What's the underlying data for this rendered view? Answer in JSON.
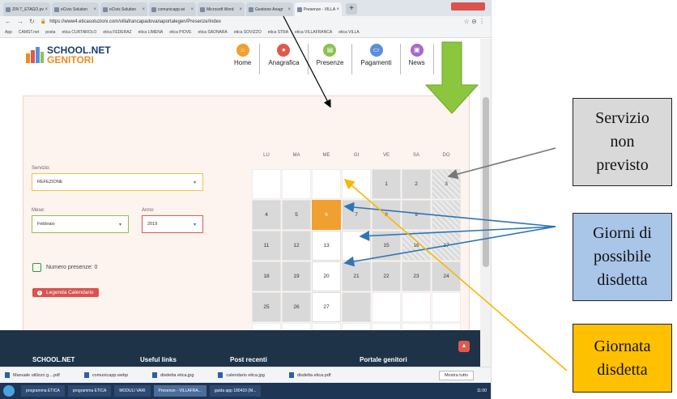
{
  "browser": {
    "tabs": [
      {
        "label": "ZIN T_ETAGO.pv"
      },
      {
        "label": "eCivis Solution"
      },
      {
        "label": "eCivis Solution"
      },
      {
        "label": "comunicapp.wi"
      },
      {
        "label": "Microsoft Word"
      },
      {
        "label": "Gestione Anagr"
      },
      {
        "label": "Presenze - VILLA"
      }
    ],
    "url": "https://www4.eticasoluzioni.com/villafrancapadovanaportalegen/Presenze/Index",
    "bookmarks": [
      "App",
      "CAMST.net",
      "posta",
      "etica CURTAROLO",
      "etica FEDERAZ",
      "etica LIMENA",
      "etica PIOVE",
      "etica SAONARA",
      "etica SOVIZZO",
      "etica STRA",
      "etica VILLAFRANCA",
      "etica VILLA"
    ]
  },
  "header": {
    "logo_line1": "SCHOOL.NET",
    "logo_line2": "GENITORI",
    "menu": [
      {
        "label": "Home",
        "color": "#f0a030"
      },
      {
        "label": "Anagrafica",
        "color": "#e0594c"
      },
      {
        "label": "Presenze",
        "color": "#8cc152"
      },
      {
        "label": "Pagamenti",
        "color": "#5b8fd9"
      },
      {
        "label": "News",
        "color": "#a56bc7"
      },
      {
        "label": "U",
        "color": "#e8a5b8"
      }
    ]
  },
  "form": {
    "servizio_label": "Servizio:",
    "servizio_value": "REFEZIONE",
    "mese_label": "Mese:",
    "mese_value": "Febbraio",
    "anno_label": "Anno:",
    "anno_value": "2019",
    "presenze_text": "Numero presenze: 0",
    "legend_button": "Legenda Calendario"
  },
  "calendar": {
    "weekdays": [
      "LU",
      "MA",
      "ME",
      "GI",
      "VE",
      "SA",
      "DO"
    ],
    "rows": [
      [
        "",
        "",
        "",
        "",
        "1",
        "2",
        "3"
      ],
      [
        "4",
        "5",
        "6",
        "7",
        "8",
        "9",
        ""
      ],
      [
        "11",
        "12",
        "13",
        "",
        "15",
        "16",
        "17"
      ],
      [
        "18",
        "19",
        "20",
        "21",
        "22",
        "23",
        "24"
      ],
      [
        "25",
        "26",
        "27",
        "",
        "",
        "",
        ""
      ],
      [
        "",
        "",
        "",
        "",
        "",
        "",
        ""
      ]
    ],
    "states": [
      [
        "empty",
        "empty",
        "empty",
        "empty",
        "grey",
        "grey",
        "hatch"
      ],
      [
        "grey",
        "grey",
        "orange",
        "grey",
        "grey",
        "grey",
        "hatch"
      ],
      [
        "grey",
        "grey",
        "white",
        "white",
        "grey",
        "hatch",
        "hatch"
      ],
      [
        "grey",
        "grey",
        "white",
        "grey",
        "grey",
        "grey",
        "grey"
      ],
      [
        "grey",
        "grey",
        "white",
        "grey",
        "empty",
        "empty",
        "empty"
      ],
      [
        "empty",
        "empty",
        "empty",
        "empty",
        "empty",
        "empty",
        "empty"
      ]
    ]
  },
  "footer": {
    "brand": "SCHOOL.NET",
    "col1": "Useful links",
    "col2": "Post recenti",
    "col3": "Portale genitori"
  },
  "downloads": {
    "items": [
      "Manuale utilizzo g....pdf",
      "comunicapp.webp",
      "disdetta etica.jpg",
      "calendario etica.jpg",
      "disdetta etica.pdf"
    ],
    "show_all": "Mostra tutto"
  },
  "taskbar": {
    "items": [
      "programma ETICA",
      "programma ETICA",
      "MODULI VARI",
      "Presenze - VILLAFRA...",
      "guida app 180410 (M..."
    ],
    "clock": "11:00"
  },
  "annotations": {
    "servizio_non_previsto": [
      "Servizio",
      "non",
      "previsto"
    ],
    "giorni_disdetta": [
      "Giorni di",
      "possibile",
      "disdetta"
    ],
    "giornata_disdetta": [
      "Giornata",
      "disdetta"
    ],
    "colors": {
      "grey_box": "#d9d9d9",
      "blue_box": "#a9c5e8",
      "yellow_box": "#ffc000",
      "green_arrow": "#8cc63e",
      "blue_arrow": "#2e75b6",
      "yellow_line": "#f5b800"
    }
  }
}
